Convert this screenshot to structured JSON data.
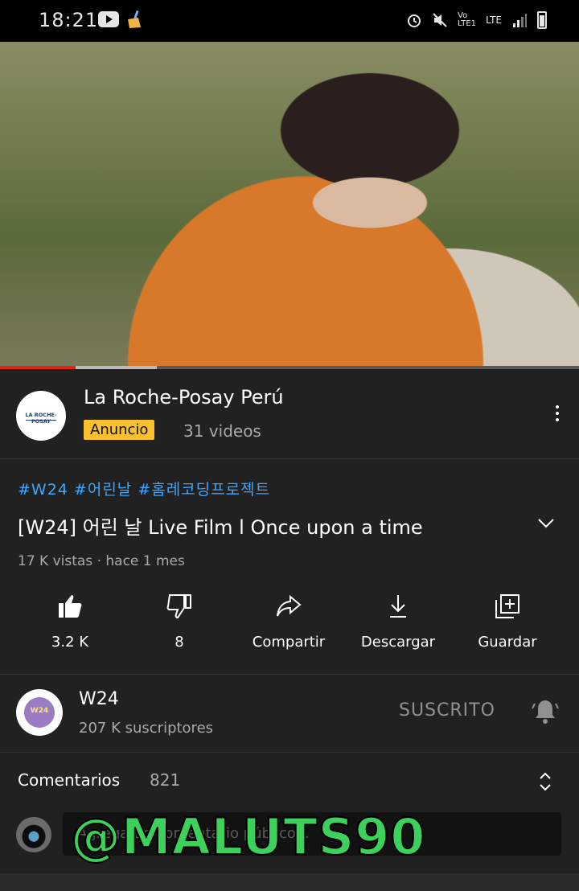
{
  "status_bar": {
    "time": "18:21",
    "icons": [
      "youtube-icon",
      "broom-icon",
      "alarm-icon",
      "mute-icon",
      "volte-lte-icon",
      "signal-icon",
      "battery-icon"
    ],
    "network": "LTE"
  },
  "player": {
    "progress": 0.13,
    "buffered": 0.27
  },
  "ad": {
    "advertiser": "La Roche-Posay Perú",
    "logo_text": "LA ROCHE-POSAY",
    "badge": "Anuncio",
    "videos": "31 videos",
    "badge_color": "#fbc02d"
  },
  "video": {
    "hashtags": "#W24 #어린날 #홈레코딩프로젝트",
    "title": "[W24] 어린 날 Live Film l Once upon a time",
    "meta": "17 K vistas · hace 1 mes",
    "hashtag_color": "#3ea6ff"
  },
  "actions": [
    {
      "icon": "like-icon",
      "label": "3.2 K"
    },
    {
      "icon": "dislike-icon",
      "label": "8"
    },
    {
      "icon": "share-icon",
      "label": "Compartir"
    },
    {
      "icon": "download-icon",
      "label": "Descargar"
    },
    {
      "icon": "save-icon",
      "label": "Guardar"
    }
  ],
  "channel": {
    "name": "W24",
    "subscribers": "207 K suscriptores",
    "subscribe_state": "SUSCRITO",
    "avatar_text": "W24"
  },
  "comments": {
    "label": "Comentarios",
    "count": "821",
    "placeholder": "Agrega un comentario público..."
  },
  "watermark": "@MALUTS90"
}
